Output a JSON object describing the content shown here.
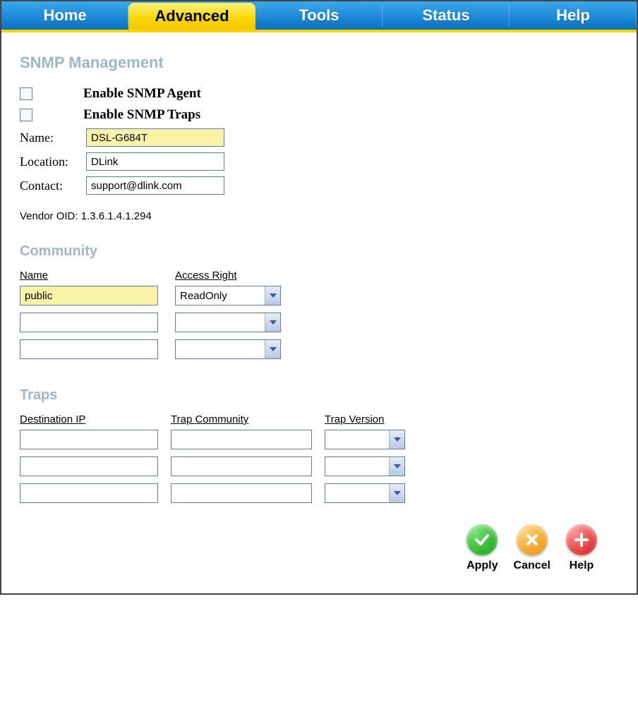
{
  "tabs": {
    "home": "Home",
    "advanced": "Advanced",
    "tools": "Tools",
    "status": "Status",
    "help": "Help"
  },
  "snmp": {
    "heading": "SNMP Management",
    "enable_agent_label": "Enable SNMP Agent",
    "enable_traps_label": "Enable SNMP Traps",
    "name_label": "Name:",
    "name_value": "DSL-G684T",
    "location_label": "Location:",
    "location_value": "DLink",
    "contact_label": "Contact:",
    "contact_value": "support@dlink.com",
    "vendor_oid_label": "Vendor OID:",
    "vendor_oid_value": "1.3.6.1.4.1.294"
  },
  "community": {
    "heading": "Community",
    "col_name": "Name",
    "col_access": "Access Right",
    "rows": [
      {
        "name": "public",
        "access": "ReadOnly"
      },
      {
        "name": "",
        "access": ""
      },
      {
        "name": "",
        "access": ""
      }
    ]
  },
  "traps": {
    "heading": "Traps",
    "col_dest": "Destination IP",
    "col_comm": "Trap Community",
    "col_ver": "Trap Version",
    "rows": [
      {
        "dest": "",
        "comm": "",
        "ver": ""
      },
      {
        "dest": "",
        "comm": "",
        "ver": ""
      },
      {
        "dest": "",
        "comm": "",
        "ver": ""
      }
    ]
  },
  "buttons": {
    "apply": "Apply",
    "cancel": "Cancel",
    "help": "Help"
  }
}
